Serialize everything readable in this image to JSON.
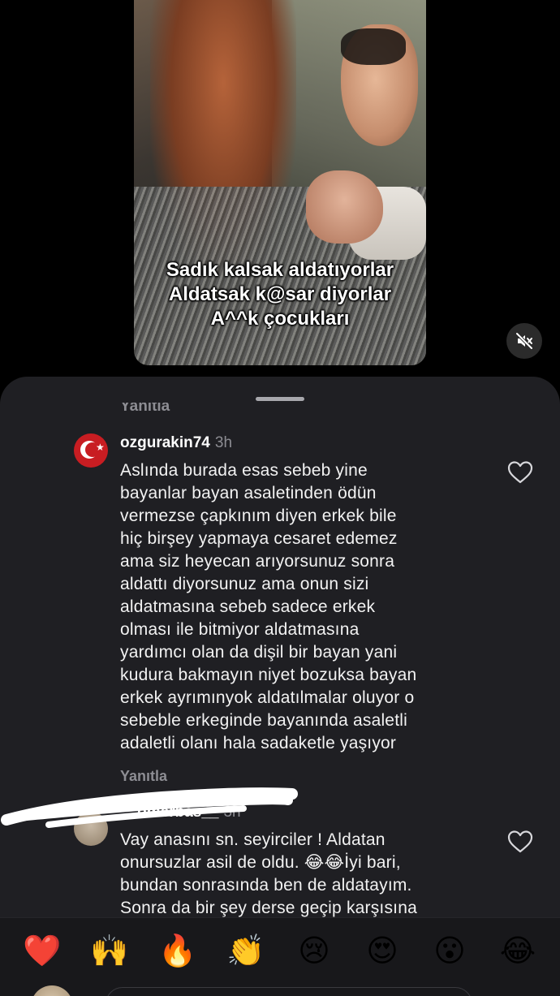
{
  "video": {
    "caption_lines": [
      "Sadık kalsak aldatıyorlar",
      "Aldatsak k@sar diyorlar",
      "A^^k çocukları"
    ],
    "mute_icon": "speaker-muted-icon"
  },
  "sheet": {
    "clipped_reply_label": "Yanıtla"
  },
  "comments": [
    {
      "username": "ozgurakin74",
      "time": "3h",
      "avatar_icon": "turkish-flag-avatar",
      "text_lines": [
        "Aslında burada esas sebeb yine",
        "bayanlar bayan asaletinden ödün",
        "vermezse çapkınım diyen  erkek bile",
        "hiç birşey yapmaya cesaret edemez",
        "ama siz heyecan arıyorsunuz sonra",
        "aldattı diyorsunuz ama onun sizi",
        "aldatmasına sebeb sadece erkek",
        "olması ile bitmiyor aldatmasına",
        "yardımcı olan da dişil bir bayan yani",
        "kudura bakmayın niyet bozuksa bayan",
        "erkek ayrımınyok aldatılmalar oluyor o",
        "sebeble erkeginde bayanında asaletli",
        "adaletli olanı hala sadaketle yaşıyor"
      ],
      "reply_label": "Yanıtla",
      "like_icon": "heart-outline-icon"
    },
    {
      "username": "__omerbas__",
      "time": "3h",
      "text_lines": [
        "Vay anasını sn. seyirciler ! Aldatan",
        "onursuzlar asil de oldu. 😂😂İyi bari,",
        "bundan sonrasında ben de aldatayım.",
        "Sonra da bir şey derse geçip karşısına"
      ],
      "like_icon": "heart-outline-icon"
    }
  ],
  "reactions": [
    "❤️",
    "🙌",
    "🔥",
    "👏",
    "😢",
    "😍",
    "😮",
    "😂"
  ],
  "colors": {
    "sheet_bg": "#1f1f23",
    "muted_text": "#8d8d93",
    "text": "#f2f2f2"
  }
}
